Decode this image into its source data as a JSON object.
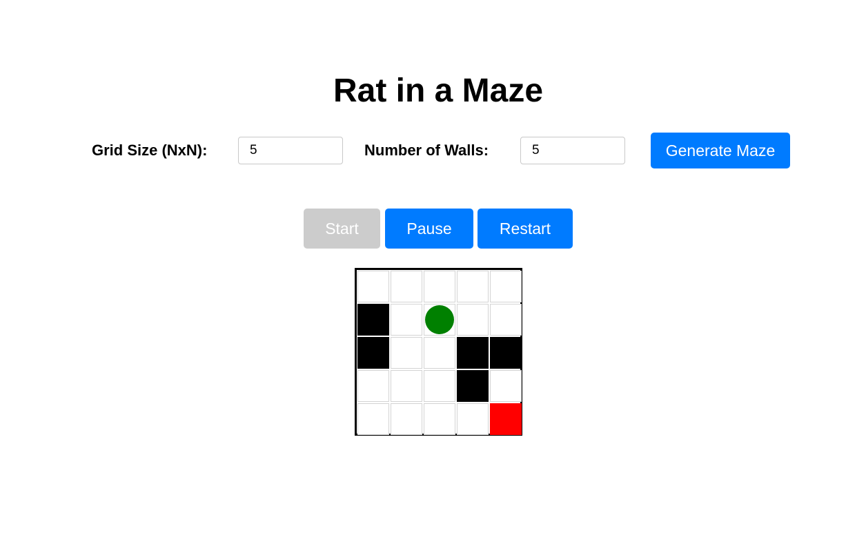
{
  "title": "Rat in a Maze",
  "controls": {
    "grid_size_label": "Grid Size (NxN):",
    "grid_size_value": "5",
    "walls_label": "Number of Walls:",
    "walls_value": "5",
    "generate_label": "Generate Maze"
  },
  "actions": {
    "start_label": "Start",
    "start_disabled": true,
    "pause_label": "Pause",
    "restart_label": "Restart"
  },
  "colors": {
    "accent": "#007bff",
    "disabled": "#cccccc",
    "wall": "#000000",
    "goal": "#ff0000",
    "rat": "#008000"
  },
  "maze": {
    "size": 5,
    "cells": [
      [
        "empty",
        "empty",
        "empty",
        "empty",
        "empty"
      ],
      [
        "wall",
        "empty",
        "rat",
        "empty",
        "empty"
      ],
      [
        "wall",
        "empty",
        "empty",
        "wall",
        "wall"
      ],
      [
        "empty",
        "empty",
        "empty",
        "wall",
        "empty"
      ],
      [
        "empty",
        "empty",
        "empty",
        "empty",
        "goal"
      ]
    ]
  }
}
